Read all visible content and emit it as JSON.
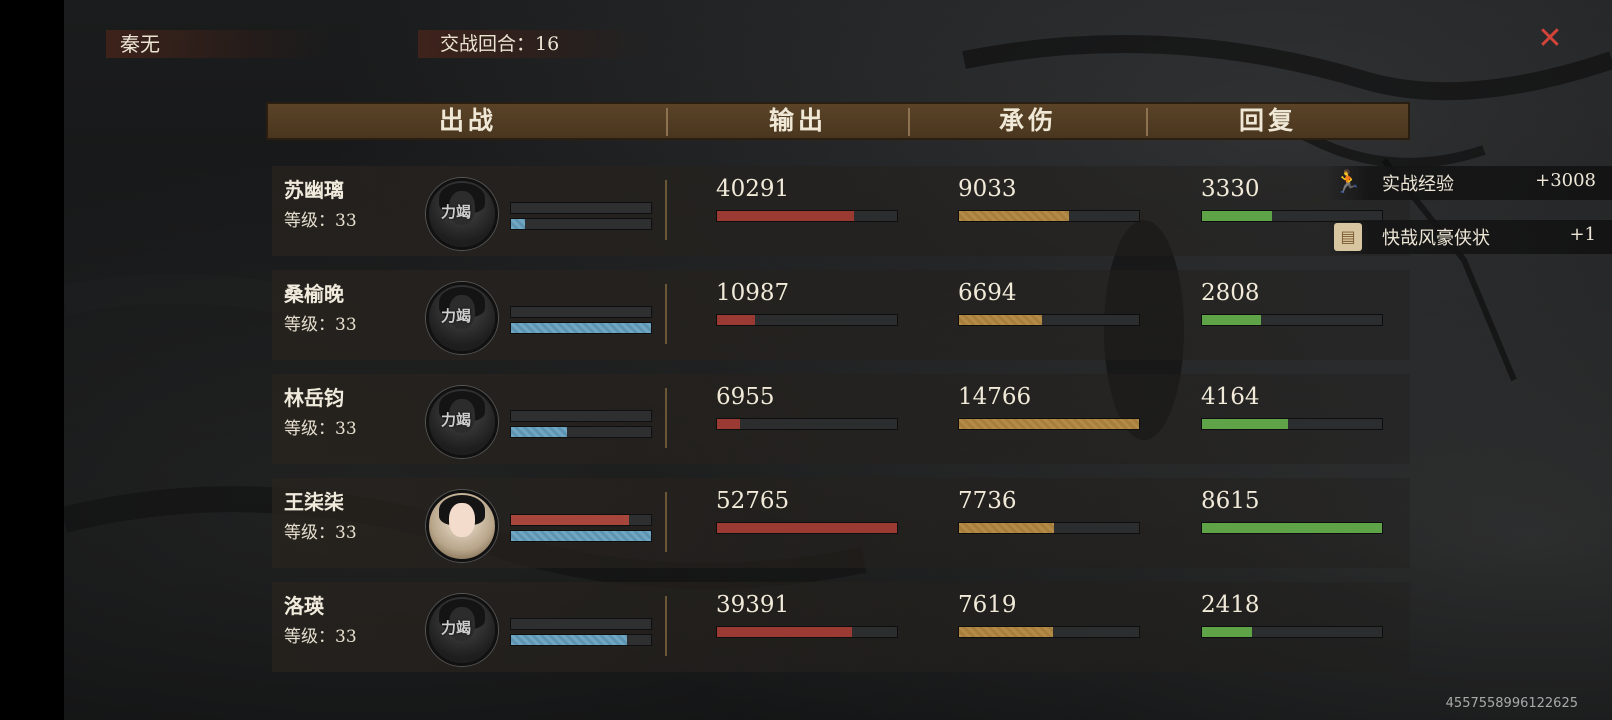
{
  "header": {
    "player_name": "秦无",
    "round_label": "交战回合：16"
  },
  "columns": {
    "deploy": "出战",
    "damage_out": "输出",
    "damage_taken": "承伤",
    "healing": "回复"
  },
  "portrait_stamp": "力竭",
  "rows": [
    {
      "name": "苏幽璃",
      "level": "等级：33",
      "exhausted": true,
      "bar_top_red_fraction": 0.0,
      "bar_bottom_blue_fraction": 0.1,
      "output": "40291",
      "output_fraction": 0.76,
      "taken": "9033",
      "taken_fraction": 0.61,
      "heal": "3330",
      "heal_fraction": 0.39
    },
    {
      "name": "桑榆晚",
      "level": "等级：33",
      "exhausted": true,
      "bar_top_red_fraction": 0.0,
      "bar_bottom_blue_fraction": 1.0,
      "output": "10987",
      "output_fraction": 0.21,
      "taken": "6694",
      "taken_fraction": 0.46,
      "heal": "2808",
      "heal_fraction": 0.33
    },
    {
      "name": "林岳钧",
      "level": "等级：33",
      "exhausted": true,
      "bar_top_red_fraction": 0.0,
      "bar_bottom_blue_fraction": 0.4,
      "output": "6955",
      "output_fraction": 0.13,
      "taken": "14766",
      "taken_fraction": 1.0,
      "heal": "4164",
      "heal_fraction": 0.48
    },
    {
      "name": "王柒柒",
      "level": "等级：33",
      "exhausted": false,
      "bar_top_red_fraction": 0.84,
      "bar_bottom_blue_fraction": 1.0,
      "output": "52765",
      "output_fraction": 1.0,
      "taken": "7736",
      "taken_fraction": 0.53,
      "heal": "8615",
      "heal_fraction": 1.0
    },
    {
      "name": "洛瑛",
      "level": "等级：33",
      "exhausted": true,
      "bar_top_red_fraction": 0.0,
      "bar_bottom_blue_fraction": 0.83,
      "output": "39391",
      "output_fraction": 0.75,
      "taken": "7619",
      "taken_fraction": 0.52,
      "heal": "2418",
      "heal_fraction": 0.28
    }
  ],
  "rewards": [
    {
      "icon": "running-figure-icon",
      "label": "实战经验",
      "value": "+3008"
    },
    {
      "icon": "scroll-icon",
      "label": "快哉风豪侠状",
      "value": "+1"
    }
  ],
  "footer_id": "4557558996122625",
  "colors": {
    "close": "#d2433a",
    "output": "#9b3a33",
    "taken": "#b38a46",
    "heal": "#5fa348",
    "hp": "#a8463c",
    "mp": "#6ea6c4"
  }
}
